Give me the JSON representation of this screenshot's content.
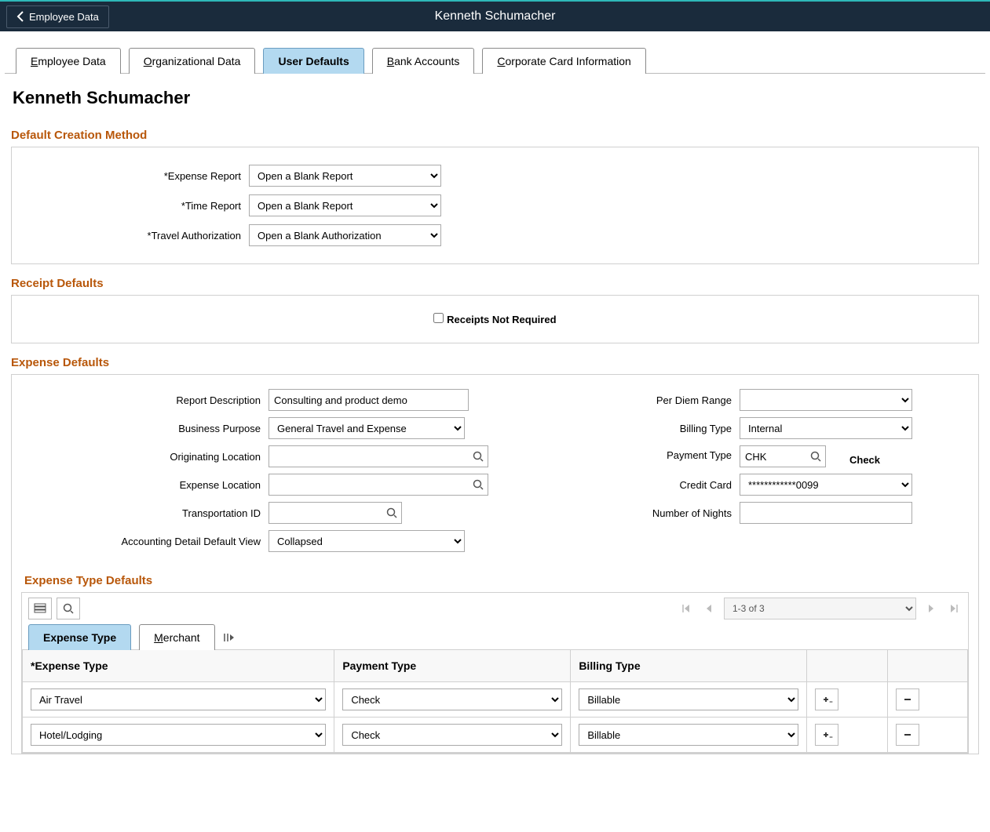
{
  "header": {
    "back_label": "Employee Data",
    "title": "Kenneth Schumacher"
  },
  "tabs": [
    {
      "hotkey": "E",
      "rest": "mployee Data"
    },
    {
      "hotkey": "O",
      "rest": "rganizational Data"
    },
    {
      "hotkey": "",
      "rest": "User Defaults",
      "active": true
    },
    {
      "hotkey": "B",
      "rest": "ank Accounts"
    },
    {
      "hotkey": "C",
      "rest": "orporate Card Information"
    }
  ],
  "page_title": "Kenneth Schumacher",
  "default_creation": {
    "section": "Default Creation Method",
    "expense_report_label": "*Expense Report",
    "expense_report_value": "Open a Blank Report",
    "time_report_label": "*Time Report",
    "time_report_value": "Open a Blank Report",
    "travel_auth_label": "*Travel Authorization",
    "travel_auth_value": "Open a Blank Authorization"
  },
  "receipt_defaults": {
    "section": "Receipt Defaults",
    "checkbox_label": "Receipts Not Required"
  },
  "expense_defaults": {
    "section": "Expense Defaults",
    "report_desc_label": "Report Description",
    "report_desc_value": "Consulting and product demo",
    "business_purpose_label": "Business Purpose",
    "business_purpose_value": "General Travel and Expense",
    "orig_loc_label": "Originating Location",
    "orig_loc_value": "",
    "exp_loc_label": "Expense Location",
    "exp_loc_value": "",
    "trans_id_label": "Transportation ID",
    "trans_id_value": "",
    "acct_view_label": "Accounting Detail Default View",
    "acct_view_value": "Collapsed",
    "per_diem_label": "Per Diem Range",
    "per_diem_value": "",
    "billing_type_label": "Billing Type",
    "billing_type_value": "Internal",
    "payment_type_label": "Payment Type",
    "payment_type_value": "CHK",
    "payment_type_desc": "Check",
    "credit_card_label": "Credit Card",
    "credit_card_value": "************0099",
    "nights_label": "Number of Nights",
    "nights_value": ""
  },
  "expense_type_defaults": {
    "section": "Expense Type Defaults",
    "pager": "1-3 of 3",
    "sub_tabs": {
      "expense_type": "Expense Type",
      "merchant_hotkey": "M",
      "merchant_rest": "erchant"
    },
    "columns": {
      "expense_type": "*Expense Type",
      "payment_type": "Payment Type",
      "billing_type": "Billing Type"
    },
    "rows": [
      {
        "expense_type": "Air Travel",
        "payment_type": "Check",
        "billing_type": "Billable"
      },
      {
        "expense_type": "Hotel/Lodging",
        "payment_type": "Check",
        "billing_type": "Billable"
      }
    ]
  }
}
